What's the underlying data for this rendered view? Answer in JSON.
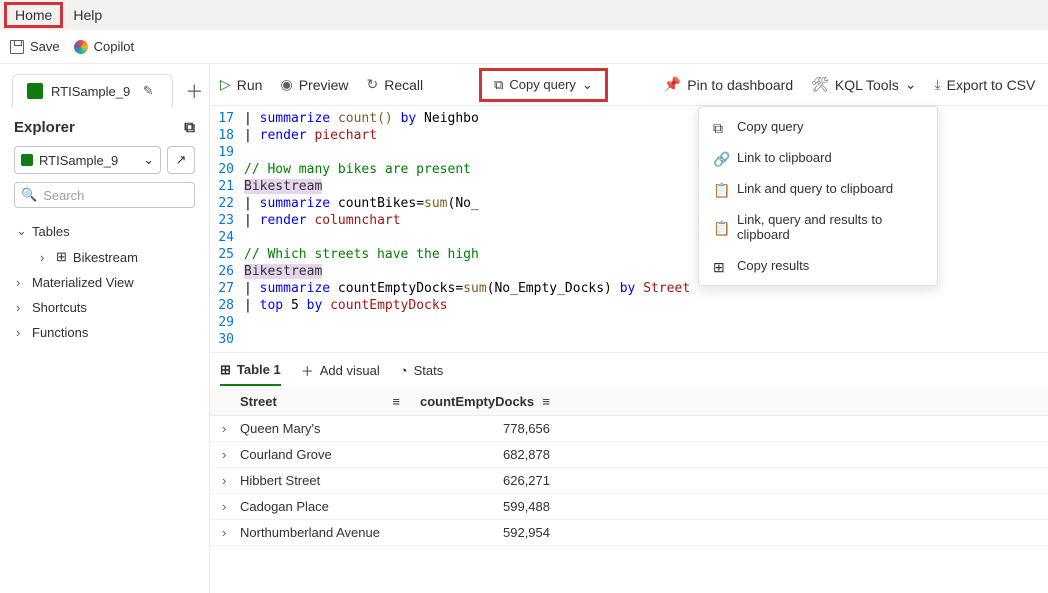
{
  "menubar": {
    "home": "Home",
    "help": "Help"
  },
  "toolbar1": {
    "save": "Save",
    "copilot": "Copilot"
  },
  "tabs": {
    "active": "RTISample_9"
  },
  "explorer": {
    "title": "Explorer",
    "db": "RTISample_9",
    "search_placeholder": "Search",
    "tree": {
      "tables": "Tables",
      "bikestream": "Bikestream",
      "matview": "Materialized View",
      "shortcuts": "Shortcuts",
      "functions": "Functions"
    }
  },
  "qt": {
    "run": "Run",
    "preview": "Preview",
    "recall": "Recall",
    "copyquery": "Copy query",
    "pin": "Pin to dashboard",
    "kqltools": "KQL Tools",
    "export": "Export to CSV"
  },
  "dropdown": {
    "copy_query": "Copy query",
    "link_clipboard": "Link to clipboard",
    "link_query_clipboard": "Link and query to clipboard",
    "link_query_results_clipboard": "Link, query and results to clipboard",
    "copy_results": "Copy results"
  },
  "editor": {
    "lines": [
      {
        "n": "17",
        "seg": [
          {
            "t": "| ",
            "c": "op"
          },
          {
            "t": "summarize",
            "c": "kw"
          },
          {
            "t": " ",
            "c": "op"
          },
          {
            "t": "count()",
            "c": "fn"
          },
          {
            "t": " ",
            "c": "op"
          },
          {
            "t": "by",
            "c": "kw"
          },
          {
            "t": " Neighbo",
            "c": "op"
          }
        ]
      },
      {
        "n": "18",
        "seg": [
          {
            "t": "| ",
            "c": "op"
          },
          {
            "t": "render",
            "c": "kw"
          },
          {
            "t": " piechart",
            "c": "id"
          }
        ]
      },
      {
        "n": "19",
        "seg": []
      },
      {
        "n": "20",
        "seg": [
          {
            "t": "// How many bikes are present ",
            "c": "cm"
          }
        ]
      },
      {
        "n": "21",
        "seg": [
          {
            "t": "Bikestream",
            "c": "hl"
          }
        ]
      },
      {
        "n": "22",
        "seg": [
          {
            "t": "| ",
            "c": "op"
          },
          {
            "t": "summarize",
            "c": "kw"
          },
          {
            "t": " countBikes=",
            "c": "op"
          },
          {
            "t": "sum",
            "c": "fn"
          },
          {
            "t": "(No_",
            "c": "op"
          }
        ]
      },
      {
        "n": "23",
        "seg": [
          {
            "t": "| ",
            "c": "op"
          },
          {
            "t": "render",
            "c": "kw"
          },
          {
            "t": " columnchart",
            "c": "id"
          }
        ]
      },
      {
        "n": "24",
        "seg": []
      },
      {
        "n": "25",
        "seg": [
          {
            "t": "// Which streets have the high",
            "c": "cm"
          }
        ]
      },
      {
        "n": "26",
        "seg": [
          {
            "t": "Bikestream",
            "c": "hl"
          }
        ]
      },
      {
        "n": "27",
        "seg": [
          {
            "t": "| ",
            "c": "op"
          },
          {
            "t": "summarize",
            "c": "kw"
          },
          {
            "t": " countEmptyDocks=",
            "c": "op"
          },
          {
            "t": "sum",
            "c": "fn"
          },
          {
            "t": "(No_Empty_Docks) ",
            "c": "op"
          },
          {
            "t": "by",
            "c": "kw"
          },
          {
            "t": " Street",
            "c": "id"
          }
        ]
      },
      {
        "n": "28",
        "seg": [
          {
            "t": "| ",
            "c": "op"
          },
          {
            "t": "top",
            "c": "kw"
          },
          {
            "t": " 5 ",
            "c": "op"
          },
          {
            "t": "by",
            "c": "kw"
          },
          {
            "t": " countEmptyDocks",
            "c": "id"
          }
        ]
      },
      {
        "n": "29",
        "seg": []
      },
      {
        "n": "30",
        "seg": []
      }
    ]
  },
  "results": {
    "tab": "Table 1",
    "addvisual": "Add visual",
    "stats": "Stats",
    "columns": {
      "street": "Street",
      "count": "countEmptyDocks"
    },
    "rows": [
      {
        "street": "Queen Mary's",
        "count": "778,656"
      },
      {
        "street": "Courland Grove",
        "count": "682,878"
      },
      {
        "street": "Hibbert Street",
        "count": "626,271"
      },
      {
        "street": "Cadogan Place",
        "count": "599,488"
      },
      {
        "street": "Northumberland Avenue",
        "count": "592,954"
      }
    ]
  }
}
